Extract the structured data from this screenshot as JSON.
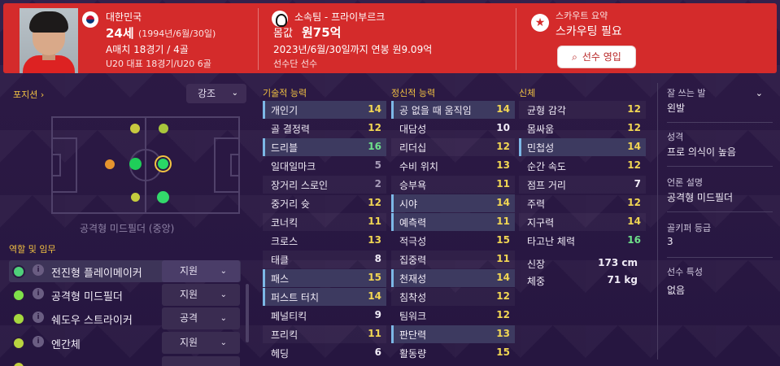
{
  "header": {
    "nationality": "대한민국",
    "age": "24세",
    "birth": "(1994년/6월/30일)",
    "caps_a": "A매치 18경기 / 4골",
    "caps_u20": "U20 대표 18경기/U20 6골",
    "club": "소속팀 - 프라이부르크",
    "value_label": "몸값",
    "value": "원75억",
    "contract": "2023년/6월/30일까지 연봉 원9.09억",
    "squad": "선수단 선수",
    "scout_title": "스카우트 요약",
    "scout_status": "스카우팅 필요",
    "recruit_button": "선수 영입"
  },
  "left": {
    "position_link": "포지션 ›",
    "emphasis_select": "강조",
    "position_caption": "공격형 미드필더 (중앙)",
    "roles_heading": "역할 및 임무",
    "roles": [
      {
        "name": "전진형 플레이메이커",
        "duty": "지원",
        "color": "#4fd17a",
        "active": true
      },
      {
        "name": "공격형 미드필더",
        "duty": "지원",
        "color": "#7fe04a"
      },
      {
        "name": "쉐도우 스트라이커",
        "duty": "공격",
        "color": "#a6d83f"
      },
      {
        "name": "엔간체",
        "duty": "지원",
        "color": "#b9d440"
      },
      {
        "name": "",
        "duty": "",
        "color": "#c2cf3d"
      }
    ]
  },
  "technical": {
    "heading": "기술적 능력",
    "items": [
      {
        "label": "개인기",
        "value": "14",
        "color": "c-yellow",
        "hl": true
      },
      {
        "label": "골 결정력",
        "value": "12",
        "color": "c-yellow"
      },
      {
        "label": "드리블",
        "value": "16",
        "color": "c-green",
        "hl": true
      },
      {
        "label": "일대일마크",
        "value": "5",
        "color": "c-gray"
      },
      {
        "label": "장거리 스로인",
        "value": "2",
        "color": "c-gray"
      },
      {
        "label": "중거리 슛",
        "value": "12",
        "color": "c-yellow"
      },
      {
        "label": "코너킥",
        "value": "11",
        "color": "c-yellow"
      },
      {
        "label": "크로스",
        "value": "13",
        "color": "c-yellow"
      },
      {
        "label": "태클",
        "value": "8",
        "color": "c-white"
      },
      {
        "label": "패스",
        "value": "15",
        "color": "c-yellow",
        "hl": true
      },
      {
        "label": "퍼스트 터치",
        "value": "14",
        "color": "c-yellow",
        "hl": true
      },
      {
        "label": "페널티킥",
        "value": "9",
        "color": "c-white"
      },
      {
        "label": "프리킥",
        "value": "11",
        "color": "c-yellow"
      },
      {
        "label": "헤딩",
        "value": "6",
        "color": "c-white"
      }
    ]
  },
  "mental": {
    "heading": "정신적 능력",
    "items": [
      {
        "label": "공 없을 때 움직임",
        "value": "14",
        "color": "c-yellow",
        "hl": true
      },
      {
        "label": "대담성",
        "value": "10",
        "color": "c-white"
      },
      {
        "label": "리더십",
        "value": "12",
        "color": "c-yellow"
      },
      {
        "label": "수비 위치",
        "value": "13",
        "color": "c-yellow"
      },
      {
        "label": "승부욕",
        "value": "11",
        "color": "c-yellow"
      },
      {
        "label": "시야",
        "value": "14",
        "color": "c-yellow",
        "hl": true
      },
      {
        "label": "예측력",
        "value": "11",
        "color": "c-yellow",
        "hl": true
      },
      {
        "label": "적극성",
        "value": "15",
        "color": "c-yellow"
      },
      {
        "label": "집중력",
        "value": "11",
        "color": "c-yellow"
      },
      {
        "label": "천재성",
        "value": "14",
        "color": "c-yellow",
        "hl": true
      },
      {
        "label": "침착성",
        "value": "12",
        "color": "c-yellow"
      },
      {
        "label": "팀워크",
        "value": "12",
        "color": "c-yellow"
      },
      {
        "label": "판단력",
        "value": "13",
        "color": "c-yellow",
        "hl": true
      },
      {
        "label": "활동량",
        "value": "15",
        "color": "c-yellow"
      }
    ]
  },
  "physical": {
    "heading": "신체",
    "items": [
      {
        "label": "균형 감각",
        "value": "12",
        "color": "c-yellow"
      },
      {
        "label": "몸싸움",
        "value": "12",
        "color": "c-yellow"
      },
      {
        "label": "민첩성",
        "value": "14",
        "color": "c-yellow",
        "hl": true
      },
      {
        "label": "순간 속도",
        "value": "12",
        "color": "c-yellow"
      },
      {
        "label": "점프 거리",
        "value": "7",
        "color": "c-white"
      },
      {
        "label": "주력",
        "value": "12",
        "color": "c-yellow"
      },
      {
        "label": "지구력",
        "value": "14",
        "color": "c-yellow"
      },
      {
        "label": "타고난 체력",
        "value": "16",
        "color": "c-green"
      }
    ],
    "height_label": "신장",
    "height": "173 cm",
    "weight_label": "체중",
    "weight": "71 kg"
  },
  "right": {
    "foot_label": "잘 쓰는 발",
    "foot": "왼발",
    "personality_label": "성격",
    "personality": "프로 의식이 높음",
    "media_label": "언론 설명",
    "media": "공격형 미드필더",
    "gk_label": "골키퍼 등급",
    "gk": "3",
    "traits_label": "선수 특성",
    "traits": "없음"
  }
}
